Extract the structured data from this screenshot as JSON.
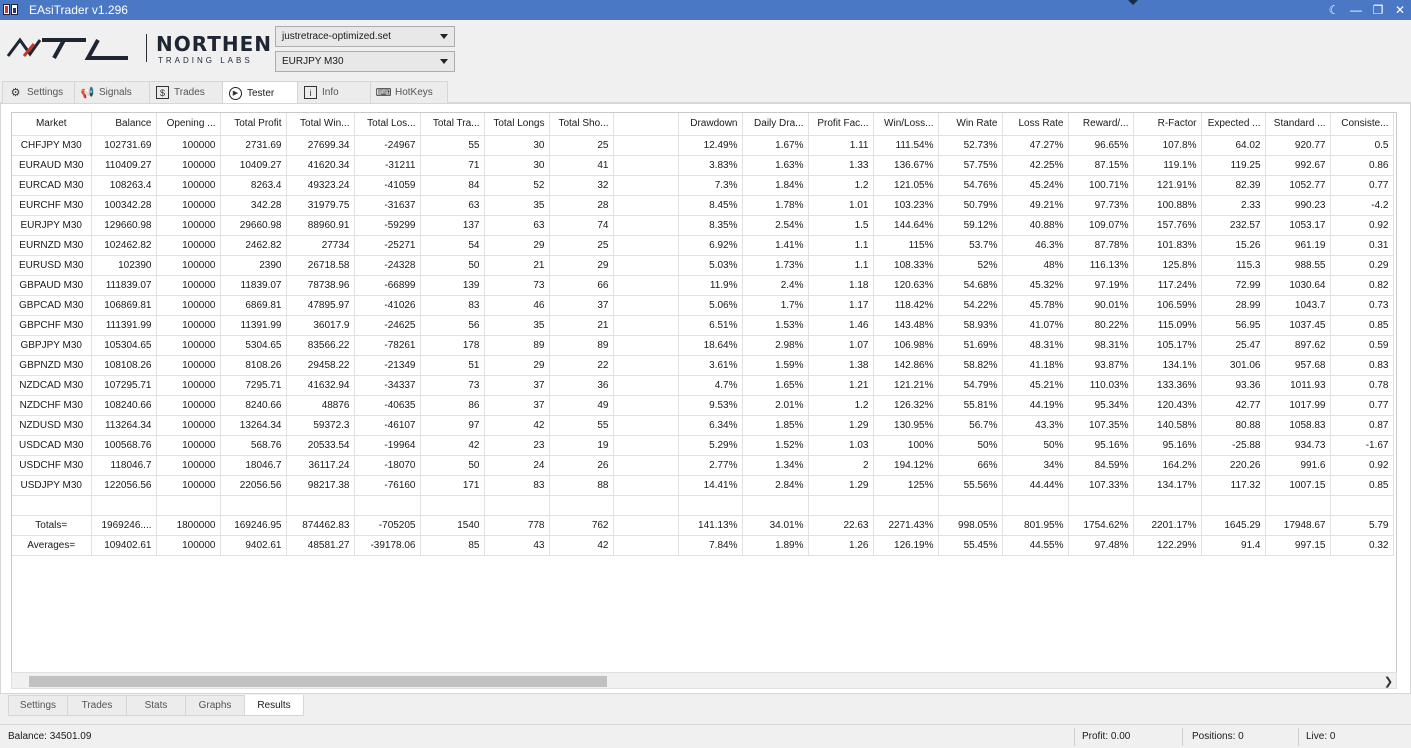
{
  "window": {
    "title": "EAsiTrader v1.296"
  },
  "brand": {
    "line1": "NORTHEN",
    "line2": "TRADING LABS"
  },
  "selectors": {
    "set_file": "justretrace-optimized.set",
    "symbol": "EURJPY M30"
  },
  "tabs": [
    {
      "label": "Settings",
      "icon": "gear-icon"
    },
    {
      "label": "Signals",
      "icon": "megaphone-icon"
    },
    {
      "label": "Trades",
      "icon": "dollar-icon"
    },
    {
      "label": "Tester",
      "icon": "play-icon"
    },
    {
      "label": "Info",
      "icon": "info-icon"
    },
    {
      "label": "HotKeys",
      "icon": "keyboard-icon"
    }
  ],
  "grid": {
    "columns": [
      "Market",
      "Balance",
      "Opening ...",
      "Total Profit",
      "Total Win...",
      "Total Los...",
      "Total Tra...",
      "Total Longs",
      "Total Sho...",
      "",
      "Drawdown",
      "Daily Dra...",
      "Profit Fac...",
      "Win/Loss...",
      "Win Rate",
      "Loss Rate",
      "Reward/...",
      "R-Factor",
      "Expected ...",
      "Standard ...",
      "Consiste..."
    ],
    "rows": [
      [
        "CHFJPY M30",
        "102731.69",
        "100000",
        "2731.69",
        "27699.34",
        "-24967",
        "55",
        "30",
        "25",
        "",
        "12.49%",
        "1.67%",
        "1.11",
        "111.54%",
        "52.73%",
        "47.27%",
        "96.65%",
        "107.8%",
        "64.02",
        "920.77",
        "0.5"
      ],
      [
        "EURAUD M30",
        "110409.27",
        "100000",
        "10409.27",
        "41620.34",
        "-31211",
        "71",
        "30",
        "41",
        "",
        "3.83%",
        "1.63%",
        "1.33",
        "136.67%",
        "57.75%",
        "42.25%",
        "87.15%",
        "119.1%",
        "119.25",
        "992.67",
        "0.86"
      ],
      [
        "EURCAD M30",
        "108263.4",
        "100000",
        "8263.4",
        "49323.24",
        "-41059",
        "84",
        "52",
        "32",
        "",
        "7.3%",
        "1.84%",
        "1.2",
        "121.05%",
        "54.76%",
        "45.24%",
        "100.71%",
        "121.91%",
        "82.39",
        "1052.77",
        "0.77"
      ],
      [
        "EURCHF M30",
        "100342.28",
        "100000",
        "342.28",
        "31979.75",
        "-31637",
        "63",
        "35",
        "28",
        "",
        "8.45%",
        "1.78%",
        "1.01",
        "103.23%",
        "50.79%",
        "49.21%",
        "97.73%",
        "100.88%",
        "2.33",
        "990.23",
        "-4.2"
      ],
      [
        "EURJPY M30",
        "129660.98",
        "100000",
        "29660.98",
        "88960.91",
        "-59299",
        "137",
        "63",
        "74",
        "",
        "8.35%",
        "2.54%",
        "1.5",
        "144.64%",
        "59.12%",
        "40.88%",
        "109.07%",
        "157.76%",
        "232.57",
        "1053.17",
        "0.92"
      ],
      [
        "EURNZD M30",
        "102462.82",
        "100000",
        "2462.82",
        "27734",
        "-25271",
        "54",
        "29",
        "25",
        "",
        "6.92%",
        "1.41%",
        "1.1",
        "115%",
        "53.7%",
        "46.3%",
        "87.78%",
        "101.83%",
        "15.26",
        "961.19",
        "0.31"
      ],
      [
        "EURUSD M30",
        "102390",
        "100000",
        "2390",
        "26718.58",
        "-24328",
        "50",
        "21",
        "29",
        "",
        "5.03%",
        "1.73%",
        "1.1",
        "108.33%",
        "52%",
        "48%",
        "116.13%",
        "125.8%",
        "115.3",
        "988.55",
        "0.29"
      ],
      [
        "GBPAUD M30",
        "111839.07",
        "100000",
        "11839.07",
        "78738.96",
        "-66899",
        "139",
        "73",
        "66",
        "",
        "11.9%",
        "2.4%",
        "1.18",
        "120.63%",
        "54.68%",
        "45.32%",
        "97.19%",
        "117.24%",
        "72.99",
        "1030.64",
        "0.82"
      ],
      [
        "GBPCAD M30",
        "106869.81",
        "100000",
        "6869.81",
        "47895.97",
        "-41026",
        "83",
        "46",
        "37",
        "",
        "5.06%",
        "1.7%",
        "1.17",
        "118.42%",
        "54.22%",
        "45.78%",
        "90.01%",
        "106.59%",
        "28.99",
        "1043.7",
        "0.73"
      ],
      [
        "GBPCHF M30",
        "111391.99",
        "100000",
        "11391.99",
        "36017.9",
        "-24625",
        "56",
        "35",
        "21",
        "",
        "6.51%",
        "1.53%",
        "1.46",
        "143.48%",
        "58.93%",
        "41.07%",
        "80.22%",
        "115.09%",
        "56.95",
        "1037.45",
        "0.85"
      ],
      [
        "GBPJPY M30",
        "105304.65",
        "100000",
        "5304.65",
        "83566.22",
        "-78261",
        "178",
        "89",
        "89",
        "",
        "18.64%",
        "2.98%",
        "1.07",
        "106.98%",
        "51.69%",
        "48.31%",
        "98.31%",
        "105.17%",
        "25.47",
        "897.62",
        "0.59"
      ],
      [
        "GBPNZD M30",
        "108108.26",
        "100000",
        "8108.26",
        "29458.22",
        "-21349",
        "51",
        "29",
        "22",
        "",
        "3.61%",
        "1.59%",
        "1.38",
        "142.86%",
        "58.82%",
        "41.18%",
        "93.87%",
        "134.1%",
        "301.06",
        "957.68",
        "0.83"
      ],
      [
        "NZDCAD M30",
        "107295.71",
        "100000",
        "7295.71",
        "41632.94",
        "-34337",
        "73",
        "37",
        "36",
        "",
        "4.7%",
        "1.65%",
        "1.21",
        "121.21%",
        "54.79%",
        "45.21%",
        "110.03%",
        "133.36%",
        "93.36",
        "1011.93",
        "0.78"
      ],
      [
        "NZDCHF M30",
        "108240.66",
        "100000",
        "8240.66",
        "48876",
        "-40635",
        "86",
        "37",
        "49",
        "",
        "9.53%",
        "2.01%",
        "1.2",
        "126.32%",
        "55.81%",
        "44.19%",
        "95.34%",
        "120.43%",
        "42.77",
        "1017.99",
        "0.77"
      ],
      [
        "NZDUSD M30",
        "113264.34",
        "100000",
        "13264.34",
        "59372.3",
        "-46107",
        "97",
        "42",
        "55",
        "",
        "6.34%",
        "1.85%",
        "1.29",
        "130.95%",
        "56.7%",
        "43.3%",
        "107.35%",
        "140.58%",
        "80.88",
        "1058.83",
        "0.87"
      ],
      [
        "USDCAD M30",
        "100568.76",
        "100000",
        "568.76",
        "20533.54",
        "-19964",
        "42",
        "23",
        "19",
        "",
        "5.29%",
        "1.52%",
        "1.03",
        "100%",
        "50%",
        "50%",
        "95.16%",
        "95.16%",
        "-25.88",
        "934.73",
        "-1.67"
      ],
      [
        "USDCHF M30",
        "118046.7",
        "100000",
        "18046.7",
        "36117.24",
        "-18070",
        "50",
        "24",
        "26",
        "",
        "2.77%",
        "1.34%",
        "2",
        "194.12%",
        "66%",
        "34%",
        "84.59%",
        "164.2%",
        "220.26",
        "991.6",
        "0.92"
      ],
      [
        "USDJPY M30",
        "122056.56",
        "100000",
        "22056.56",
        "98217.38",
        "-76160",
        "171",
        "83",
        "88",
        "",
        "14.41%",
        "2.84%",
        "1.29",
        "125%",
        "55.56%",
        "44.44%",
        "107.33%",
        "134.17%",
        "117.32",
        "1007.15",
        "0.85"
      ]
    ],
    "totals": [
      "Totals=",
      "1969246....",
      "1800000",
      "169246.95",
      "874462.83",
      "-705205",
      "1540",
      "778",
      "762",
      "",
      "141.13%",
      "34.01%",
      "22.63",
      "2271.43%",
      "998.05%",
      "801.95%",
      "1754.62%",
      "2201.17%",
      "1645.29",
      "17948.67",
      "5.79"
    ],
    "averages": [
      "Averages=",
      "109402.61",
      "100000",
      "9402.61",
      "48581.27",
      "-39178.06",
      "85",
      "43",
      "42",
      "",
      "7.84%",
      "1.89%",
      "1.26",
      "126.19%",
      "55.45%",
      "44.55%",
      "97.48%",
      "122.29%",
      "91.4",
      "997.15",
      "0.32"
    ]
  },
  "subtabs": [
    "Settings",
    "Trades",
    "Stats",
    "Graphs",
    "Results"
  ],
  "status": {
    "balance": "Balance: 34501.09",
    "profit": "Profit: 0.00",
    "positions": "Positions: 0",
    "live": "Live: 0"
  }
}
